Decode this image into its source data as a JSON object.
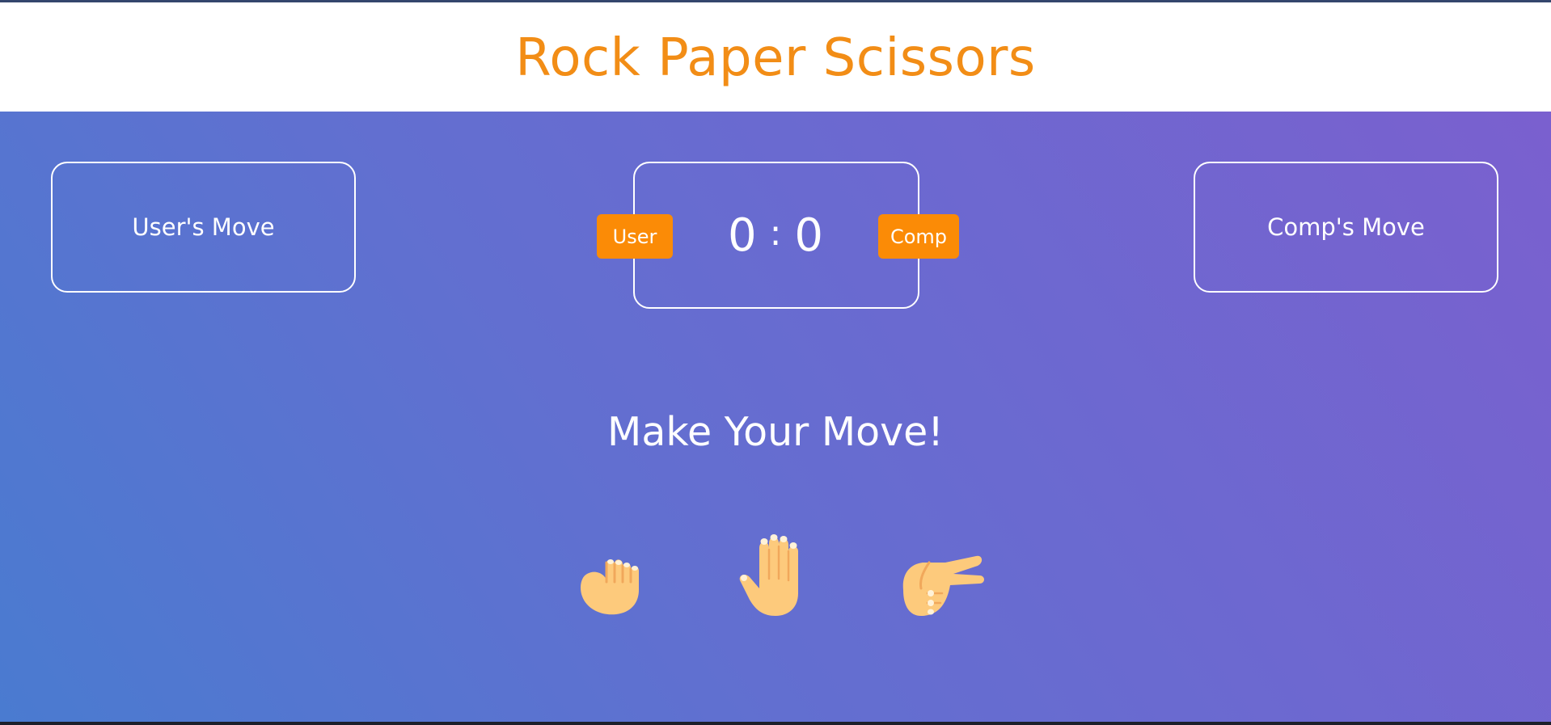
{
  "header": {
    "title": "Rock Paper Scissors"
  },
  "scoreboard": {
    "user_label": "User",
    "comp_label": "Comp",
    "user_score": "0",
    "separator": ":",
    "comp_score": "0"
  },
  "moves": {
    "user_move_label": "User's Move",
    "comp_move_label": "Comp's Move"
  },
  "prompt": "Make Your Move!",
  "choices": [
    {
      "name": "rock",
      "icon": "fist-icon"
    },
    {
      "name": "paper",
      "icon": "raised-hand-icon"
    },
    {
      "name": "scissors",
      "icon": "victory-hand-icon"
    }
  ],
  "colors": {
    "title": "#f28d16",
    "badge": "#fb8b06",
    "skin": "#fdca7c",
    "gradient_start": "#4a7bd0",
    "gradient_end": "#7a60cf"
  }
}
